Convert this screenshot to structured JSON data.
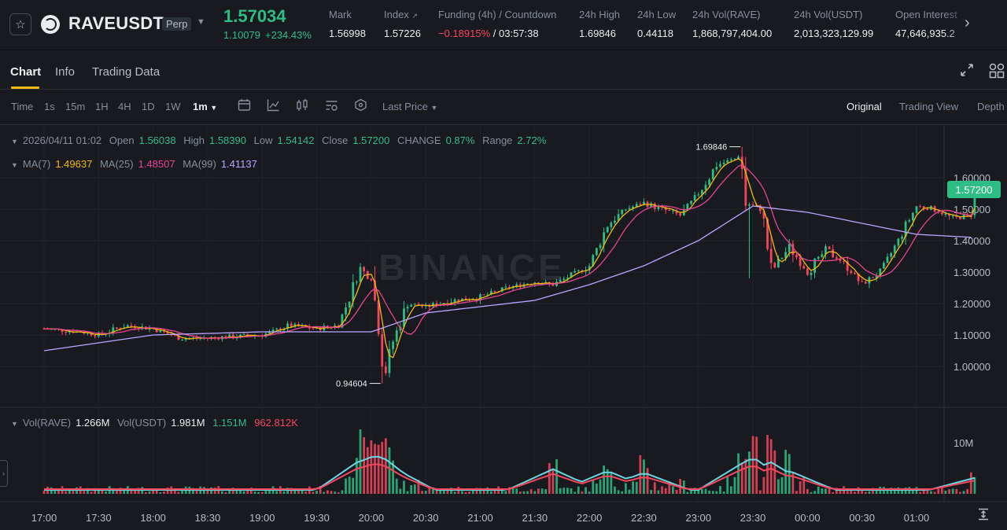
{
  "header": {
    "symbol": "RAVEUSDT",
    "contract_type": "Perp",
    "last_price": "1.57034",
    "last_price_usd": "1.10079",
    "change_pct": "+234.43%",
    "stats": [
      {
        "label": "Mark",
        "value": "1.56998"
      },
      {
        "label": "Index",
        "value": "1.57226"
      },
      {
        "label": "Funding (4h) / Countdown",
        "value_neg": "−0.18915%",
        "value_rest": " / 03:57:38"
      },
      {
        "label": "24h High",
        "value": "1.69846"
      },
      {
        "label": "24h Low",
        "value": "0.44118"
      },
      {
        "label": "24h Vol(RAVE)",
        "value": "1,868,797,404.00"
      },
      {
        "label": "24h Vol(USDT)",
        "value": "2,013,323,129.99"
      },
      {
        "label": "Open Interest",
        "value": "47,646,935.2"
      }
    ]
  },
  "tabs": [
    "Chart",
    "Info",
    "Trading Data"
  ],
  "toolbar": {
    "intervals": [
      "Time",
      "1s",
      "15m",
      "1H",
      "4H",
      "1D",
      "1W",
      "1m"
    ],
    "price_type": "Last Price",
    "views": [
      "Original",
      "Trading View",
      "Depth"
    ]
  },
  "ohlc_legend": {
    "datetime": "2026/04/11 01:02",
    "open_label": "Open",
    "open": "1.56038",
    "high_label": "High",
    "high": "1.58390",
    "low_label": "Low",
    "low": "1.54142",
    "close_label": "Close",
    "close": "1.57200",
    "change_label": "CHANGE",
    "change": "0.87%",
    "range_label": "Range",
    "range": "2.72%"
  },
  "ma_legend": {
    "ma7_label": "MA(7)",
    "ma7": "1.49637",
    "ma25_label": "MA(25)",
    "ma25": "1.48507",
    "ma99_label": "MA(99)",
    "ma99": "1.41137"
  },
  "vol_legend": {
    "vol_label": "Vol(RAVE)",
    "vol": "1.266M",
    "volusdt_label": "Vol(USDT)",
    "volusdt": "1.981M",
    "ma1": "1.151M",
    "ma2": "962.812K"
  },
  "watermark": "BINANCE",
  "current_price_badge": "1.57200",
  "colors": {
    "up": "#2ebd85",
    "down": "#f6465d",
    "ma7": "#f0b90b",
    "ma25": "#e84393",
    "ma99": "#b9a6ff",
    "vol_ma1": "#6cd6e0",
    "vol_ma2": "#f6465d",
    "accent": "#f0b90b"
  },
  "chart_data": {
    "type": "candlestick",
    "interval": "1m",
    "y_ticks": [
      "1.60000",
      "1.50000",
      "1.40000",
      "1.30000",
      "1.20000",
      "1.10000",
      "1.00000"
    ],
    "ylim": [
      0.9,
      1.72
    ],
    "x_ticks": [
      "17:00",
      "17:30",
      "18:00",
      "18:30",
      "19:00",
      "19:30",
      "20:00",
      "20:30",
      "21:00",
      "21:30",
      "22:00",
      "22:30",
      "23:00",
      "23:30",
      "00:00",
      "00:30",
      "01:00"
    ],
    "vol_ticks": [
      "10M"
    ],
    "annotations": [
      {
        "text": "1.69846",
        "kind": "high"
      },
      {
        "text": "0.94604",
        "kind": "low"
      }
    ],
    "price_path": [
      {
        "t": "16:30",
        "p": 1.12
      },
      {
        "t": "16:50",
        "p": 1.11
      },
      {
        "t": "17:00",
        "p": 1.1
      },
      {
        "t": "17:15",
        "p": 1.13
      },
      {
        "t": "17:30",
        "p": 1.12
      },
      {
        "t": "17:45",
        "p": 1.09
      },
      {
        "t": "18:00",
        "p": 1.09
      },
      {
        "t": "18:30",
        "p": 1.1
      },
      {
        "t": "18:45",
        "p": 1.13
      },
      {
        "t": "19:00",
        "p": 1.12
      },
      {
        "t": "19:12",
        "p": 1.13
      },
      {
        "t": "19:20",
        "p": 1.25
      },
      {
        "t": "19:24",
        "p": 1.31
      },
      {
        "t": "19:30",
        "p": 1.28
      },
      {
        "t": "19:35",
        "p": 1.1
      },
      {
        "t": "19:37",
        "p": 0.96
      },
      {
        "t": "19:42",
        "p": 1.08
      },
      {
        "t": "19:50",
        "p": 1.2
      },
      {
        "t": "20:00",
        "p": 1.19
      },
      {
        "t": "20:15",
        "p": 1.21
      },
      {
        "t": "20:30",
        "p": 1.22
      },
      {
        "t": "20:45",
        "p": 1.25
      },
      {
        "t": "21:00",
        "p": 1.27
      },
      {
        "t": "21:10",
        "p": 1.26
      },
      {
        "t": "21:20",
        "p": 1.29
      },
      {
        "t": "21:30",
        "p": 1.32
      },
      {
        "t": "21:40",
        "p": 1.45
      },
      {
        "t": "21:50",
        "p": 1.5
      },
      {
        "t": "22:00",
        "p": 1.52
      },
      {
        "t": "22:10",
        "p": 1.5
      },
      {
        "t": "22:20",
        "p": 1.48
      },
      {
        "t": "22:30",
        "p": 1.55
      },
      {
        "t": "22:40",
        "p": 1.64
      },
      {
        "t": "22:50",
        "p": 1.66
      },
      {
        "t": "22:53",
        "p": 1.68
      },
      {
        "t": "22:56",
        "p": 1.52
      },
      {
        "t": "23:00",
        "p": 1.51
      },
      {
        "t": "23:05",
        "p": 1.5
      },
      {
        "t": "23:10",
        "p": 1.3
      },
      {
        "t": "23:20",
        "p": 1.38
      },
      {
        "t": "23:30",
        "p": 1.3
      },
      {
        "t": "23:40",
        "p": 1.37
      },
      {
        "t": "23:50",
        "p": 1.33
      },
      {
        "t": "00:00",
        "p": 1.26
      },
      {
        "t": "00:10",
        "p": 1.3
      },
      {
        "t": "00:20",
        "p": 1.4
      },
      {
        "t": "00:30",
        "p": 1.51
      },
      {
        "t": "00:40",
        "p": 1.5
      },
      {
        "t": "00:50",
        "p": 1.47
      },
      {
        "t": "01:00",
        "p": 1.48
      },
      {
        "t": "01:02",
        "p": 1.572
      }
    ],
    "ma99_path": [
      {
        "t": "16:30",
        "p": 1.05
      },
      {
        "t": "17:30",
        "p": 1.1
      },
      {
        "t": "18:30",
        "p": 1.11
      },
      {
        "t": "19:30",
        "p": 1.11
      },
      {
        "t": "20:00",
        "p": 1.17
      },
      {
        "t": "21:00",
        "p": 1.21
      },
      {
        "t": "21:30",
        "p": 1.26
      },
      {
        "t": "22:00",
        "p": 1.32
      },
      {
        "t": "22:30",
        "p": 1.4
      },
      {
        "t": "23:00",
        "p": 1.51
      },
      {
        "t": "23:30",
        "p": 1.49
      },
      {
        "t": "00:30",
        "p": 1.42
      },
      {
        "t": "01:02",
        "p": 1.41
      }
    ]
  }
}
